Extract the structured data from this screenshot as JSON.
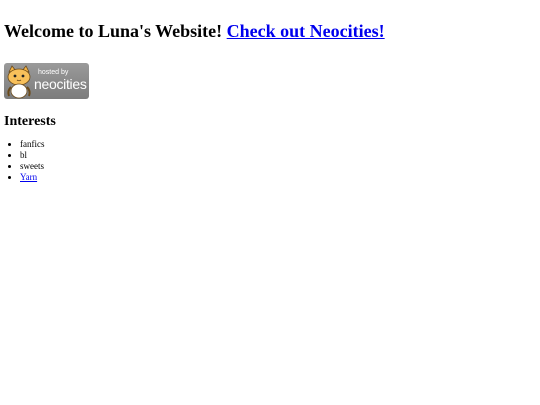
{
  "header": {
    "title": "Welcome to Luna's Website!",
    "link_label": "Check out Neocities!"
  },
  "badge": {
    "hosted_text": "hosted by",
    "brand_text": "neocities",
    "icon": "neocities-cat-icon"
  },
  "interests": {
    "heading": "Interests",
    "items": [
      {
        "label": "fanfics",
        "is_link": false
      },
      {
        "label": "bl",
        "is_link": false
      },
      {
        "label": "sweets",
        "is_link": false
      },
      {
        "label": "Yarn",
        "is_link": true
      }
    ]
  },
  "colors": {
    "link": "#0000ee",
    "badge_bg": "#8a8a8a",
    "text": "#000000"
  }
}
